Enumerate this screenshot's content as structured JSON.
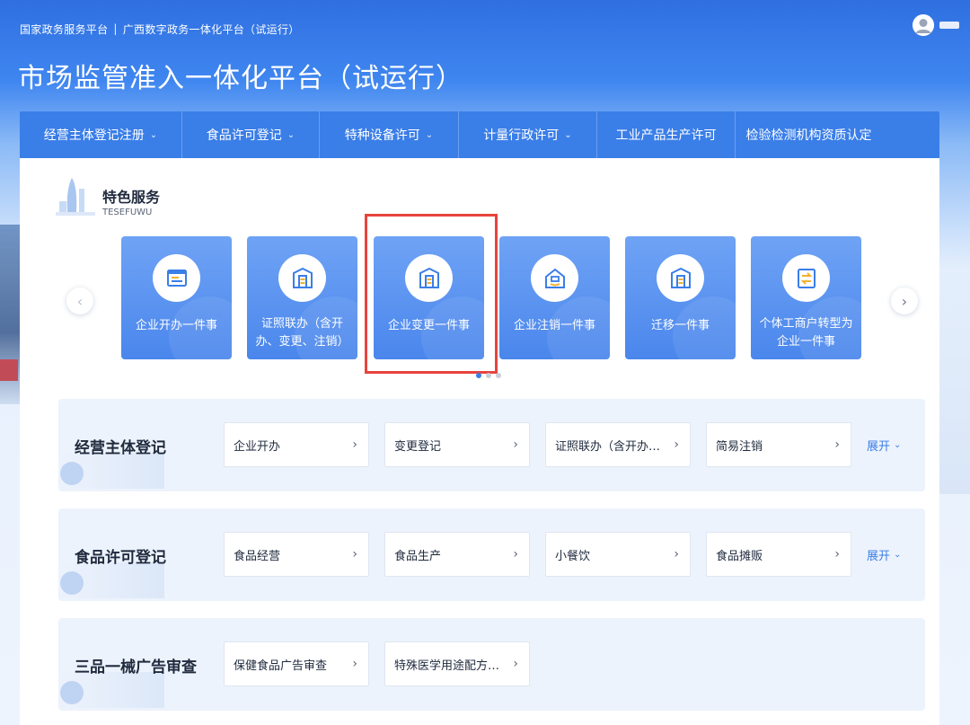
{
  "header": {
    "breadcrumb_left": "国家政务服务平台",
    "breadcrumb_sep": "|",
    "breadcrumb_right": "广西数字政务一体化平台（试运行）",
    "page_title": "市场监管准入一体化平台（试运行）"
  },
  "nav": {
    "items": [
      {
        "label": "经营主体登记注册",
        "has_dropdown": true
      },
      {
        "label": "食品许可登记",
        "has_dropdown": true
      },
      {
        "label": "特种设备许可",
        "has_dropdown": true
      },
      {
        "label": "计量行政许可",
        "has_dropdown": true
      },
      {
        "label": "工业产品生产许可",
        "has_dropdown": false
      },
      {
        "label": "检验检测机构资质认定",
        "has_dropdown": false
      }
    ],
    "dropdown_glyph": "⌄"
  },
  "feature": {
    "title": "特色服务",
    "subtitle": "TESEFUWU",
    "prev_glyph": "‹",
    "next_glyph": "›",
    "cards": [
      {
        "label": "企业开办一件事",
        "icon": "form-window-icon"
      },
      {
        "label": "证照联办（含开办、变更、注销）",
        "icon": "building-icon"
      },
      {
        "label": "企业变更一件事",
        "icon": "building-icon"
      },
      {
        "label": "企业注销一件事",
        "icon": "house-icon"
      },
      {
        "label": "迁移一件事",
        "icon": "building-icon"
      },
      {
        "label": "个体工商户转型为企业一件事",
        "icon": "transfer-icon"
      }
    ],
    "highlighted_card": 2,
    "active_page": 0,
    "page_count": 3
  },
  "sections": [
    {
      "title": "经营主体登记",
      "services": [
        "企业开办",
        "变更登记",
        "证照联办（含开办…",
        "简易注销"
      ],
      "expand_label": "展开"
    },
    {
      "title": "食品许可登记",
      "services": [
        "食品经营",
        "食品生产",
        "小餐饮",
        "食品摊贩"
      ],
      "expand_label": "展开"
    },
    {
      "title": "三品一械广告审查",
      "services": [
        "保健食品广告审查",
        "特殊医学用途配方…"
      ],
      "expand_label": ""
    }
  ],
  "glyphs": {
    "arrow_right": "›",
    "chevron_down": "⌄"
  },
  "colors": {
    "primary": "#3a7ee8",
    "highlight": "#e8433d",
    "card": "#5a91ef"
  }
}
